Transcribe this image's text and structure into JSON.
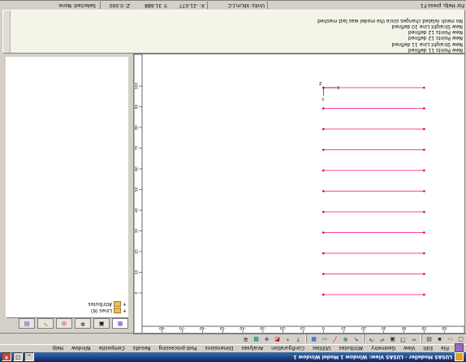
{
  "title_bar": {
    "title": "LUSAS Modeller - LUSAS View: Window 1 Model Window 1",
    "buttons": [
      "_",
      "□",
      "x"
    ]
  },
  "menu_bar": {
    "items": [
      "File",
      "Edit",
      "View",
      "Geometry",
      "Attributes",
      "Utilities",
      "Configuration",
      "Analyses",
      "Dimensions",
      "Post-processing",
      "Results",
      "Composite",
      "Window",
      "Help"
    ]
  },
  "toolbar": {
    "icons": [
      "new-icon",
      "open-icon",
      "save-icon",
      "print-icon",
      "cut-icon",
      "copy-icon",
      "paste-icon",
      "undo-icon",
      "redo-icon",
      "select-icon",
      "zoom-icon",
      "line-icon",
      "rectangle-icon",
      "layer-icon",
      "help-icon",
      "point-icon",
      "surface-icon",
      "volume-icon",
      "mesh-icon",
      "properties-icon"
    ]
  },
  "left_panel": {
    "tree": [
      {
        "label": "Lines (6)"
      },
      {
        "label": "Attributes"
      }
    ],
    "tabs": [
      "layers-tab",
      "groups-tab",
      "attributes-tab",
      "analyses-tab",
      "utilities-tab",
      "reports-tab"
    ]
  },
  "canvas": {
    "line_color": "#ff40a0",
    "end_marker_color": "#cc0044",
    "horizontal_ruler_labels": [
      "-80",
      "-70",
      "-60",
      "-50",
      "-40",
      "-30",
      "-20",
      "-10",
      "0",
      "10",
      "20",
      "30",
      "40",
      "50",
      "60"
    ],
    "vertical_ruler_labels": [
      "0",
      "10",
      "20",
      "30",
      "40",
      "50",
      "60",
      "70",
      "80",
      "90",
      "100"
    ],
    "axis_labels": [
      "X",
      "Y",
      "Z"
    ]
  },
  "messages": {
    "lines": [
      "New Points 11 defined",
      "New Straight Line 11 defined",
      "New Points 12 defined",
      "New Points 12 defined",
      "New Straight Line 10 defined",
      "No mesh related changes since the model was last meshed"
    ]
  },
  "status_bar": {
    "title": "For Help, press F1",
    "units": "Units: kN,m,t,C",
    "x": "X: -21.077",
    "y": "Y: 31.688",
    "z": "Z: 0.000",
    "selected": "Selected: None"
  }
}
